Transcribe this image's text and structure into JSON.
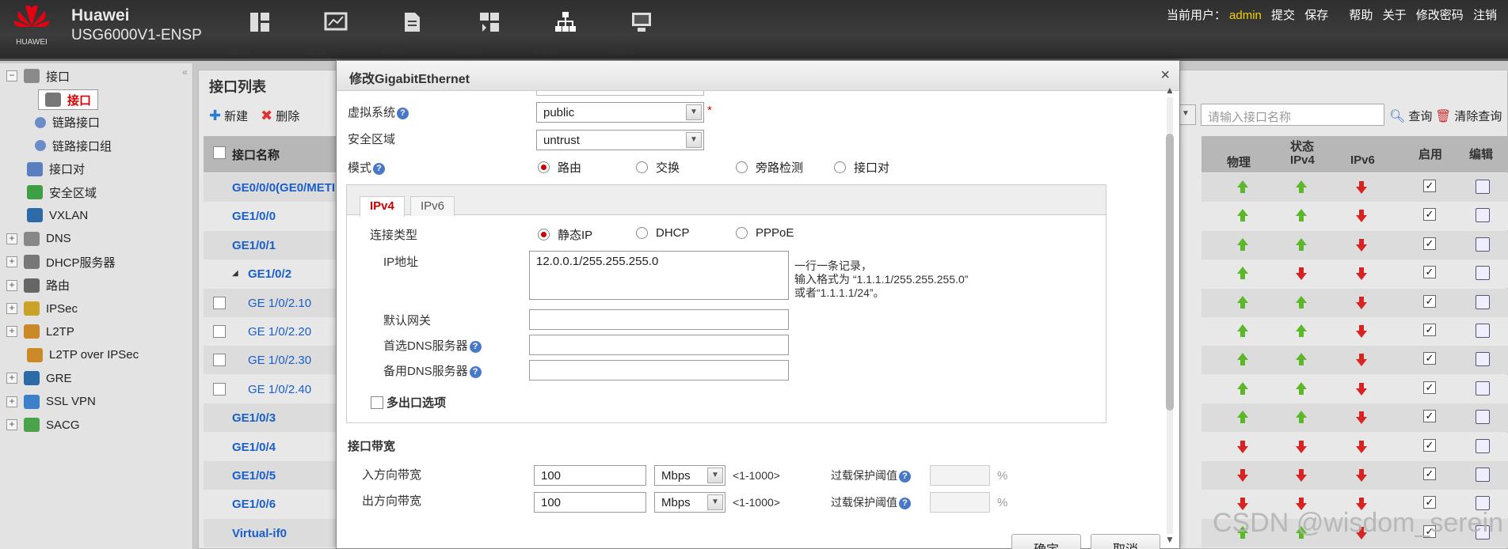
{
  "header": {
    "brand_logo_text": "HUAWEI",
    "brand_line1": "Huawei",
    "brand_line2": "USG6000V1-ENSP",
    "nav": [
      {
        "label": "面板",
        "icon": "dashboard-icon"
      },
      {
        "label": "监控",
        "icon": "monitor-icon"
      },
      {
        "label": "策略",
        "icon": "policy-icon"
      },
      {
        "label": "对象",
        "icon": "object-icon"
      },
      {
        "label": "网络",
        "icon": "network-icon"
      },
      {
        "label": "系统",
        "icon": "system-icon"
      }
    ],
    "user_label": "当前用户：",
    "user": "admin",
    "links": [
      "提交",
      "保存",
      "帮助",
      "关于",
      "修改密码",
      "注销"
    ]
  },
  "tree": {
    "items": [
      {
        "label": "接口",
        "expander": "−"
      },
      {
        "label": "接口",
        "selected": true
      },
      {
        "label": "链路接口"
      },
      {
        "label": "链路接口组"
      },
      {
        "label": "接口对"
      },
      {
        "label": "安全区域"
      },
      {
        "label": "VXLAN"
      },
      {
        "label": "DNS",
        "expander": "+"
      },
      {
        "label": "DHCP服务器",
        "expander": "+"
      },
      {
        "label": "路由",
        "expander": "+"
      },
      {
        "label": "IPSec",
        "expander": "+"
      },
      {
        "label": "L2TP",
        "expander": "+"
      },
      {
        "label": "L2TP over IPSec"
      },
      {
        "label": "GRE",
        "expander": "+"
      },
      {
        "label": "SSL VPN",
        "expander": "+"
      },
      {
        "label": "SACG",
        "expander": "+"
      }
    ]
  },
  "list": {
    "title": "接口列表",
    "new_label": "新建",
    "delete_label": "删除",
    "col_name": "接口名称",
    "search_placeholder": "请输入接口名称",
    "query_label": "查询",
    "clear_label": "清除查询",
    "col_status": "状态",
    "col_phys": "物理",
    "col_ipv4": "IPv4",
    "col_ipv6": "IPv6",
    "col_enable": "启用",
    "col_edit": "编辑",
    "rows": [
      {
        "name": "GE0/0/0(GE0/METI",
        "sub": false,
        "phys": "up",
        "ipv4": "up",
        "ipv6": "down"
      },
      {
        "name": "GE1/0/0",
        "sub": false,
        "phys": "up",
        "ipv4": "up",
        "ipv6": "down"
      },
      {
        "name": "GE1/0/1",
        "sub": false,
        "phys": "up",
        "ipv4": "up",
        "ipv6": "down"
      },
      {
        "name": "GE1/0/2",
        "sub": false,
        "parent": true,
        "phys": "up",
        "ipv4": "down",
        "ipv6": "down"
      },
      {
        "name": "GE 1/0/2.10",
        "sub": true,
        "phys": "up",
        "ipv4": "up",
        "ipv6": "down"
      },
      {
        "name": "GE 1/0/2.20",
        "sub": true,
        "phys": "up",
        "ipv4": "up",
        "ipv6": "down"
      },
      {
        "name": "GE 1/0/2.30",
        "sub": true,
        "phys": "up",
        "ipv4": "up",
        "ipv6": "down"
      },
      {
        "name": "GE 1/0/2.40",
        "sub": true,
        "phys": "up",
        "ipv4": "up",
        "ipv6": "down"
      },
      {
        "name": "GE1/0/3",
        "sub": false,
        "phys": "up",
        "ipv4": "up",
        "ipv6": "down"
      },
      {
        "name": "GE1/0/4",
        "sub": false,
        "phys": "down",
        "ipv4": "down",
        "ipv6": "down"
      },
      {
        "name": "GE1/0/5",
        "sub": false,
        "phys": "down",
        "ipv4": "down",
        "ipv6": "down"
      },
      {
        "name": "GE1/0/6",
        "sub": false,
        "phys": "down",
        "ipv4": "down",
        "ipv6": "down"
      },
      {
        "name": "Virtual-if0",
        "sub": false,
        "phys": "up",
        "ipv4": "up",
        "ipv6": "down"
      }
    ]
  },
  "dialog": {
    "title": "修改GigabitEthernet",
    "close": "×",
    "vsys_label": "虚拟系统",
    "vsys_value": "public",
    "required": "*",
    "zone_label": "安全区域",
    "zone_value": "untrust",
    "mode_label": "模式",
    "modes": [
      "路由",
      "交换",
      "旁路检测",
      "接口对"
    ],
    "tabs": [
      "IPv4",
      "IPv6"
    ],
    "conn_label": "连接类型",
    "conn_types": [
      "静态IP",
      "DHCP",
      "PPPoE"
    ],
    "ip_label": "IP地址",
    "ip_value": "12.0.0.1/255.255.255.0",
    "ip_hint1": "一行一条记录，",
    "ip_hint2": "输入格式为 “1.1.1.1/255.255.255.0”",
    "ip_hint3": "或者“1.1.1.1/24”。",
    "gw_label": "默认网关",
    "dns1_label": "首选DNS服务器",
    "dns2_label": "备用DNS服务器",
    "multi_label": "多出口选项",
    "bw_title": "接口带宽",
    "in_label": "入方向带宽",
    "out_label": "出方向带宽",
    "in_value": "100",
    "out_value": "100",
    "unit": "Mbps",
    "range": "<1-1000>",
    "overload_label": "过载保护阈值",
    "pct": "%",
    "ok": "确定",
    "cancel": "取消"
  },
  "watermark": "CSDN @wisdom_serein",
  "colors": {
    "link": "#1a5fc8",
    "selected": "#cc0000",
    "up": "#5cb82a",
    "down": "#d82323"
  }
}
